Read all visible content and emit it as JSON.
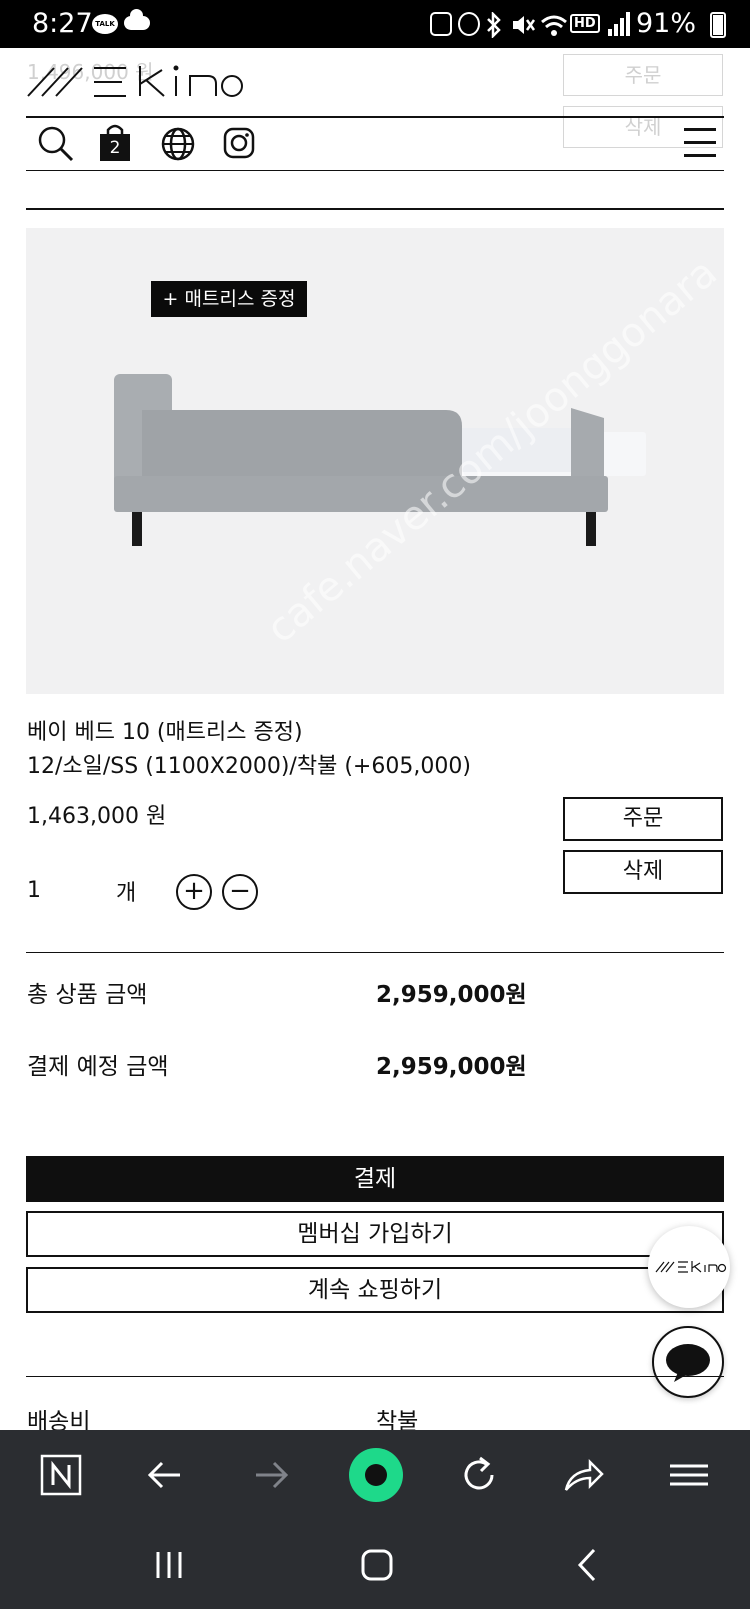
{
  "status_bar": {
    "time": "8:27",
    "talk_badge": "TALK",
    "battery": "91%",
    "hd_label": "HD"
  },
  "header": {
    "logo_text": "WEKINO",
    "cart_count": "2",
    "faded_price": "1,496,000 원",
    "faded_order": "주문",
    "faded_delete": "삭제"
  },
  "product": {
    "badge": "+ 매트리스 증정",
    "watermark": "cafe.naver.com/joonggonara",
    "name": "베이 베드 10 (매트리스 증정)",
    "option": "12/소일/SS (1100X2000)/착불 (+605,000)",
    "price": "1,463,000 원",
    "order_button": "주문",
    "delete_button": "삭제",
    "quantity": "1",
    "quantity_unit": "개",
    "increment_symbol": "+",
    "decrement_symbol": "−"
  },
  "summary": {
    "total_label": "총 상품 금액",
    "total_value": "2,959,000원",
    "expected_label": "결제 예정 금액",
    "expected_value": "2,959,000원"
  },
  "actions": {
    "pay": "결제",
    "membership": "멤버십 가입하기",
    "continue_shopping": "계속 쇼핑하기"
  },
  "shipping": {
    "label": "배송비",
    "value": "착불"
  },
  "fab": {
    "logo_text": "WEKINO"
  },
  "colors": {
    "accent": "#111111",
    "image_bg": "#f1f1f2",
    "bar_bg": "#2b2d31",
    "home_green": "#1ed98a"
  }
}
